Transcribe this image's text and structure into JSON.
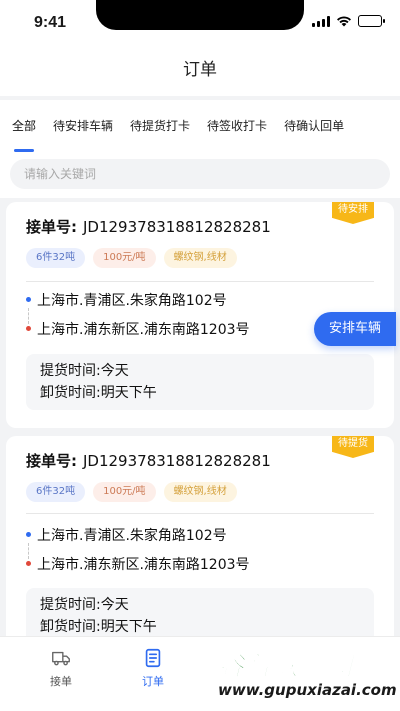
{
  "status_bar": {
    "time": "9:41"
  },
  "nav": {
    "title": "订单"
  },
  "tabs": [
    {
      "label": "全部",
      "active": true
    },
    {
      "label": "待安排车辆",
      "active": false
    },
    {
      "label": "待提货打卡",
      "active": false
    },
    {
      "label": "待签收打卡",
      "active": false
    },
    {
      "label": "待确认回单",
      "active": false
    }
  ],
  "search": {
    "placeholder": "请输入关键词",
    "value": ""
  },
  "orders": [
    {
      "status_badge": "待安排",
      "order_label": "接单号:",
      "order_no": "JD129378318812828281",
      "tags": [
        "6件32吨",
        "100元/吨",
        "螺纹钢,线材"
      ],
      "from": "上海市.青浦区.朱家角路102号",
      "to": "上海市.浦东新区.浦东南路1203号",
      "pickup_label": "提货时间:",
      "pickup_value": "今天",
      "unload_label": "卸货时间:",
      "unload_value": "明天下午",
      "action_label": "安排车辆"
    },
    {
      "status_badge": "待提货",
      "order_label": "接单号:",
      "order_no": "JD129378318812828281",
      "tags": [
        "6件32吨",
        "100元/吨",
        "螺纹钢,线材"
      ],
      "from": "上海市.青浦区.朱家角路102号",
      "to": "上海市.浦东新区.浦东南路1203号",
      "pickup_label": "提货时间:",
      "pickup_value": "今天",
      "unload_label": "卸货时间:",
      "unload_value": "明天下午"
    }
  ],
  "tabbar": [
    {
      "label": "接单",
      "icon": "truck-icon",
      "active": false
    },
    {
      "label": "订单",
      "icon": "order-list-icon",
      "active": true
    }
  ],
  "watermark": {
    "brand": "谷普软件园",
    "url": "www.gupuxiazai.com"
  },
  "colors": {
    "accent": "#2f6bf0",
    "badge": "#f7b718",
    "from_dot": "#2f6bf0",
    "to_dot": "#e0483a"
  }
}
